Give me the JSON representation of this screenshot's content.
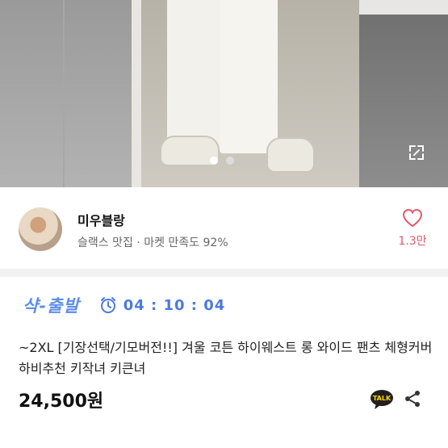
{
  "gallery": {
    "photo_alt": "",
    "pager": {
      "count": 2,
      "active_index": 0
    },
    "expand_icon": "expand-icon"
  },
  "seller": {
    "name": "미우블랑",
    "meta": "슬랙스 맛집 · 마켓 만족도 92%",
    "avatar_icon": "avatar",
    "like": {
      "icon": "heart-icon",
      "count": "1.3만",
      "color": "#e05a6a"
    }
  },
  "product": {
    "badge": "샥-출발",
    "badge_color": "#5e8eea",
    "timer_icon": "alarm-clock-icon",
    "timer": "04 : 10 : 04",
    "timer_color": "#4a7ae2",
    "title": "~2XL [기장선택/기모버전!!] 겨울 코튼 하이웨스트 롱 와이드 팬츠 체형커버 하비추천 키작녀 키큰녀",
    "price": "24,500원",
    "talk_icon": "talk-icon",
    "talk_label": "TALK",
    "share_icon": "share-icon"
  }
}
